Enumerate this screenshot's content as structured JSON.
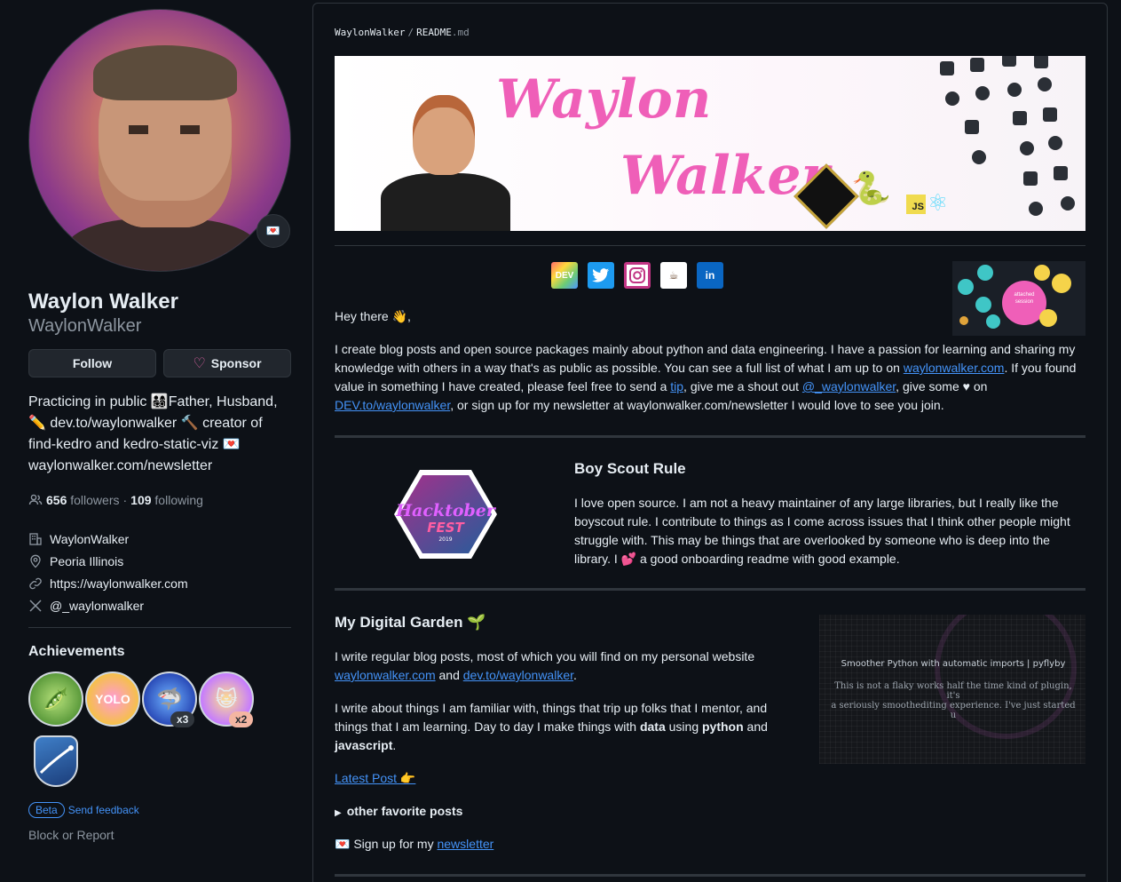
{
  "profile": {
    "full_name": "Waylon Walker",
    "username": "WaylonWalker",
    "follow_label": "Follow",
    "sponsor_label": "Sponsor",
    "bio_1": "Practicing in public 👨‍👩‍👧‍👦Father, Husband,",
    "bio_2": "✏️ dev.to/waylonwalker 🔨 creator of",
    "bio_3": "find-kedro and kedro-static-viz 💌",
    "bio_4": "waylonwalker.com/newsletter",
    "followers_count": "656",
    "followers_label": "followers",
    "dot": "·",
    "following_count": "109",
    "following_label": "following",
    "company": "WaylonWalker",
    "location": "Peoria Illinois",
    "website": "https://waylonwalker.com",
    "twitter": "@_waylonwalker",
    "status_emoji": "💌"
  },
  "achievements": {
    "title": "Achievements",
    "badges": [
      {
        "name": "Pair Extraordinaire",
        "emoji": "🫛",
        "count": ""
      },
      {
        "name": "YOLO",
        "emoji": "YOLO",
        "count": ""
      },
      {
        "name": "Pull Shark",
        "emoji": "🦈",
        "count": "x3"
      },
      {
        "name": "Starstruck",
        "emoji": "😺",
        "count": "x2"
      },
      {
        "name": "Arctic Code Vault",
        "emoji": "",
        "count": ""
      }
    ]
  },
  "footer": {
    "beta": "Beta",
    "feedback": "Send feedback",
    "block": "Block or Report"
  },
  "readme": {
    "breadcrumb_user": "WaylonWalker",
    "breadcrumb_sep": "/",
    "breadcrumb_file": "README",
    "breadcrumb_ext": ".md",
    "banner_name_1": "Waylon",
    "banner_name_2": "Walker",
    "social": [
      "DEV",
      "t",
      "ig",
      "☕",
      "in"
    ],
    "greeting": "Hey there 👋,",
    "intro_1": "I create blog posts and open source packages mainly about python and data engineering. I have a passion for learning and sharing my knowledge with others in a way that's as public as possible. You can see a full list of what I am up to on ",
    "intro_link_1": "waylonwalker.com",
    "intro_2": ". If you found value in something I have created, please feel free to send a ",
    "intro_link_tip": "tip",
    "intro_3": ", give me a shout out ",
    "intro_link_tw": "@_waylonwalker",
    "intro_4": ", give some ♥ on ",
    "intro_link_dev": "DEV.to/waylonwalker",
    "intro_5": ", or sign up for my newsletter at waylonwalker.com/newsletter I would love to see you join.",
    "scout_title": "Boy Scout Rule",
    "scout_text": "I love open source. I am not a heavy maintainer of any large libraries, but I really like the boyscout rule. I contribute to things as I come across issues that I think other people might struggle with. This may be things that are overlooked by someone who is deep into the library. I 💕 a good onboarding readme with good example.",
    "hack_text_1": "Hacktober",
    "hack_text_2": "FEST",
    "hack_year": "2019",
    "garden_title": "My Digital Garden 🌱",
    "garden_p1_a": "I write regular blog posts, most of which you will find on my personal website ",
    "garden_p1_link1": "waylonwalker.com",
    "garden_p1_b": " and ",
    "garden_p1_link2": "dev.to/waylonwalker",
    "garden_p1_c": ".",
    "garden_p2_a": "I write about things I am familiar with, things that trip up folks that I mentor, and things that I am learning. Day to day I make things with ",
    "garden_p2_data": "data",
    "garden_p2_b": " using ",
    "garden_p2_python": "python",
    "garden_p2_c": " and ",
    "garden_p2_js": "javascript",
    "garden_p2_d": ".",
    "latest_post": "Latest Post 👉",
    "favorites": "other favorite posts",
    "newsletter_a": "💌 Sign up for my ",
    "newsletter_link": "newsletter",
    "garden_img_title": "Smoother Python with automatic imports | pyflyby",
    "garden_img_sub_1": "This is not a flaky works half the time kind of plugin, it's",
    "garden_img_sub_2": "a seriously smoothediting experience.  I've just started u",
    "mindmap_center_1": "attached",
    "mindmap_center_2": "session"
  },
  "colors": {
    "bg": "#0d1117",
    "text": "#e6edf3",
    "muted": "#8d96a0",
    "link": "#4493f8",
    "border": "#30363d",
    "banner_pink": "#ef5fb8",
    "sponsor_heart": "#db61a2"
  }
}
